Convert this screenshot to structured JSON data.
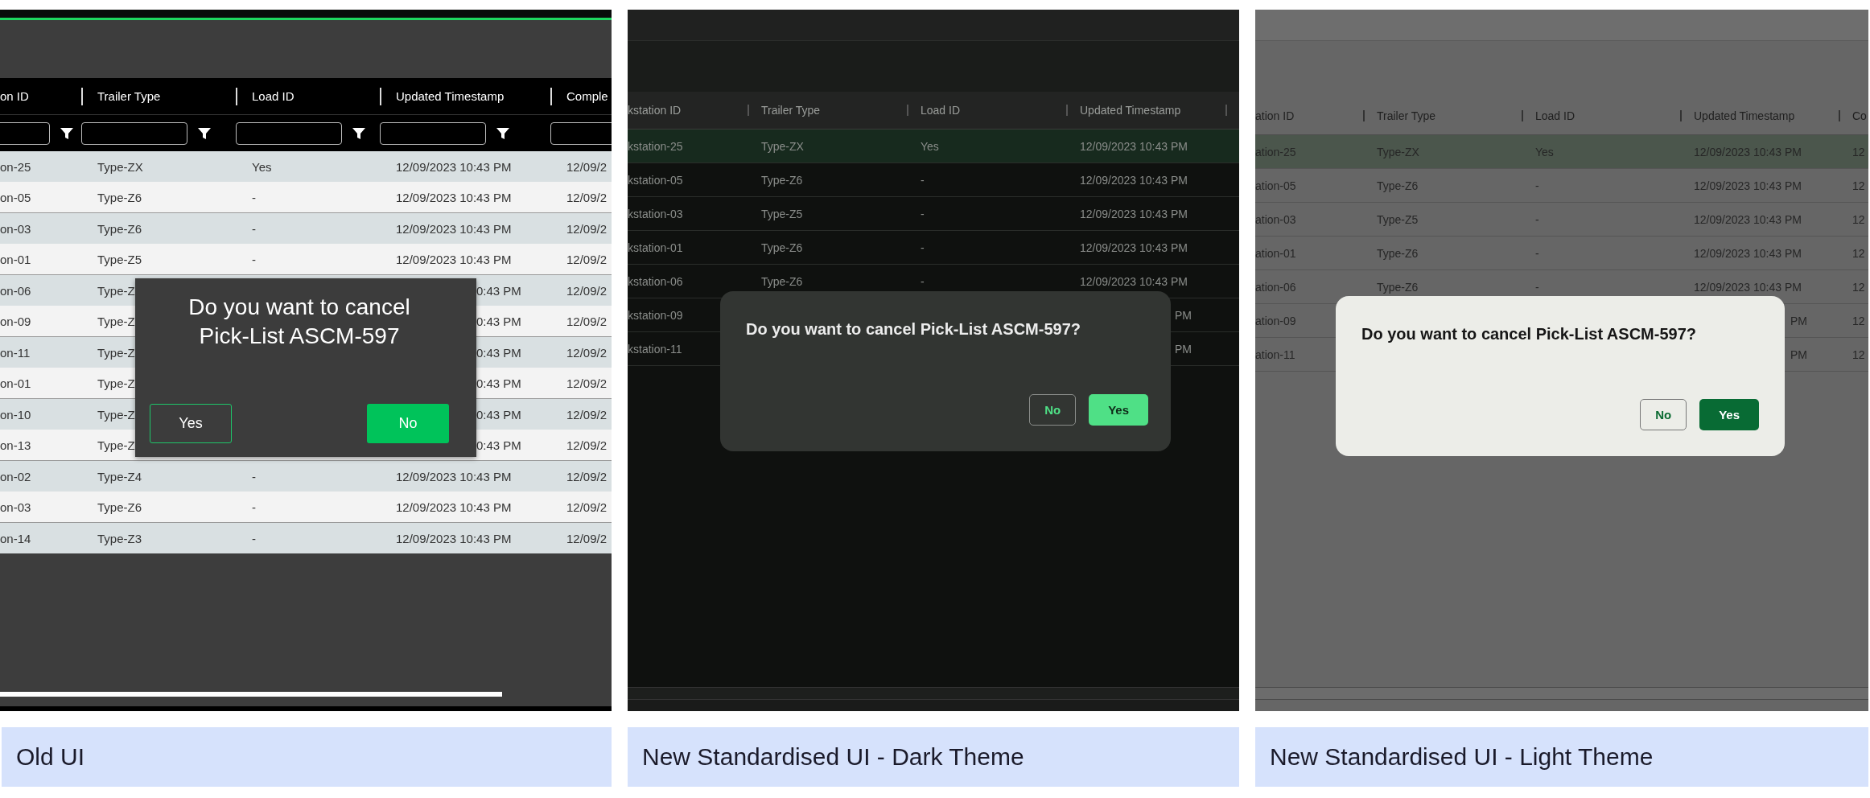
{
  "panels": [
    {
      "kind": "old",
      "caption": "Old UI",
      "columns": [
        {
          "label": "on ID",
          "filter": true
        },
        {
          "label": "Trailer Type",
          "filter": true
        },
        {
          "label": "Load ID",
          "filter": true
        },
        {
          "label": "Updated Timestamp",
          "filter": true
        },
        {
          "label": "Comple",
          "filter": true
        }
      ],
      "rows": [
        {
          "kind": "plain",
          "selected": false,
          "cells": [
            "on-25",
            "Type-ZX",
            "Yes",
            "12/09/2023 10:43 PM",
            "12/09/2"
          ]
        },
        {
          "kind": "plain",
          "selected": false,
          "cells": [
            "on-05",
            "Type-Z6",
            "-",
            "12/09/2023 10:43 PM",
            "12/09/2"
          ]
        },
        {
          "kind": "plain",
          "selected": false,
          "cells": [
            "on-03",
            "Type-Z6",
            "-",
            "12/09/2023 10:43 PM",
            "12/09/2"
          ]
        },
        {
          "kind": "plain",
          "selected": false,
          "cells": [
            "on-01",
            "Type-Z5",
            "-",
            "12/09/2023 10:43 PM",
            "12/09/2"
          ]
        },
        {
          "kind": "behind-dialog",
          "selected": false,
          "cells": [
            "on-06",
            "Type-Z",
            null,
            "0:43 PM",
            "12/09/2"
          ]
        },
        {
          "kind": "behind-dialog",
          "selected": false,
          "cells": [
            "on-09",
            "Type-Z",
            null,
            "0:43 PM",
            "12/09/2"
          ]
        },
        {
          "kind": "behind-dialog",
          "selected": false,
          "cells": [
            "on-11",
            "Type-Z",
            null,
            "0:43 PM",
            "12/09/2"
          ]
        },
        {
          "kind": "behind-dialog",
          "selected": false,
          "cells": [
            "on-01",
            "Type-Z",
            null,
            "0:43 PM",
            "12/09/2"
          ]
        },
        {
          "kind": "behind-dialog",
          "selected": false,
          "cells": [
            "on-10",
            "Type-Z",
            null,
            "0:43 PM",
            "12/09/2"
          ]
        },
        {
          "kind": "behind-dialog",
          "selected": false,
          "cells": [
            "on-13",
            "Type-Z",
            null,
            "0:43 PM",
            "12/09/2"
          ]
        },
        {
          "kind": "plain",
          "selected": false,
          "cells": [
            "on-02",
            "Type-Z4",
            "-",
            "12/09/2023 10:43 PM",
            "12/09/2"
          ]
        },
        {
          "kind": "plain",
          "selected": false,
          "cells": [
            "on-03",
            "Type-Z6",
            "-",
            "12/09/2023 10:43 PM",
            "12/09/2"
          ]
        },
        {
          "kind": "plain",
          "selected": false,
          "cells": [
            "on-14",
            "Type-Z3",
            "-",
            "12/09/2023 10:43 PM",
            "12/09/2"
          ]
        }
      ],
      "dialog": {
        "message": "Do you want to cancel Pick-List ASCM-597",
        "buttons": [
          {
            "label": "Yes",
            "kind": "outline"
          },
          {
            "label": "No",
            "kind": "filled"
          }
        ]
      }
    },
    {
      "kind": "dark",
      "caption": "New Standardised UI - Dark Theme",
      "columns": [
        {
          "label": "kstation ID"
        },
        {
          "label": "Trailer Type"
        },
        {
          "label": "Load ID"
        },
        {
          "label": "Updated Timestamp"
        }
      ],
      "rows": [
        {
          "kind": "plain",
          "selected": true,
          "cells": [
            "kstation-25",
            "Type-ZX",
            "Yes",
            "12/09/2023 10:43 PM"
          ]
        },
        {
          "kind": "plain",
          "selected": false,
          "cells": [
            "kstation-05",
            "Type-Z6",
            "-",
            "12/09/2023 10:43 PM"
          ]
        },
        {
          "kind": "plain",
          "selected": false,
          "cells": [
            "kstation-03",
            "Type-Z5",
            "-",
            "12/09/2023 10:43 PM"
          ]
        },
        {
          "kind": "plain",
          "selected": false,
          "cells": [
            "kstation-01",
            "Type-Z6",
            "-",
            "12/09/2023 10:43 PM"
          ]
        },
        {
          "kind": "plain",
          "selected": false,
          "cells": [
            "kstation-06",
            "Type-Z6",
            "-",
            "12/09/2023 10:43 PM"
          ]
        },
        {
          "kind": "behind-dialog",
          "selected": false,
          "cells": [
            "kstation-09",
            null,
            null,
            "PM"
          ]
        },
        {
          "kind": "behind-dialog",
          "selected": false,
          "cells": [
            "kstation-11",
            null,
            null,
            "PM"
          ]
        }
      ],
      "dialog": {
        "message": "Do you want to cancel Pick-List ASCM-597?",
        "buttons": [
          {
            "label": "No",
            "kind": "outline"
          },
          {
            "label": "Yes",
            "kind": "filled"
          }
        ]
      }
    },
    {
      "kind": "light",
      "caption": "New Standardised UI - Light Theme",
      "columns": [
        {
          "label": "ation ID"
        },
        {
          "label": "Trailer Type"
        },
        {
          "label": "Load ID"
        },
        {
          "label": "Updated Timestamp"
        },
        {
          "label": "Co"
        }
      ],
      "rows": [
        {
          "kind": "plain",
          "selected": true,
          "cells": [
            "ation-25",
            "Type-ZX",
            "Yes",
            "12/09/2023 10:43 PM",
            "12"
          ]
        },
        {
          "kind": "plain",
          "selected": false,
          "cells": [
            "ation-05",
            "Type-Z6",
            "-",
            "12/09/2023 10:43 PM",
            "12"
          ]
        },
        {
          "kind": "plain",
          "selected": false,
          "cells": [
            "ation-03",
            "Type-Z5",
            "-",
            "12/09/2023 10:43 PM",
            "12"
          ]
        },
        {
          "kind": "plain",
          "selected": false,
          "cells": [
            "ation-01",
            "Type-Z6",
            "-",
            "12/09/2023 10:43 PM",
            "12"
          ]
        },
        {
          "kind": "plain",
          "selected": false,
          "cells": [
            "ation-06",
            "Type-Z6",
            "-",
            "12/09/2023 10:43 PM",
            "12"
          ]
        },
        {
          "kind": "behind-dialog",
          "selected": false,
          "cells": [
            "ation-09",
            null,
            null,
            "PM",
            "12"
          ]
        },
        {
          "kind": "behind-dialog",
          "selected": false,
          "cells": [
            "ation-11",
            null,
            null,
            "PM",
            "12"
          ]
        }
      ],
      "dialog": {
        "message": "Do you want to cancel Pick-List ASCM-597?",
        "buttons": [
          {
            "label": "No",
            "kind": "outline"
          },
          {
            "label": "Yes",
            "kind": "filled"
          }
        ]
      }
    }
  ]
}
